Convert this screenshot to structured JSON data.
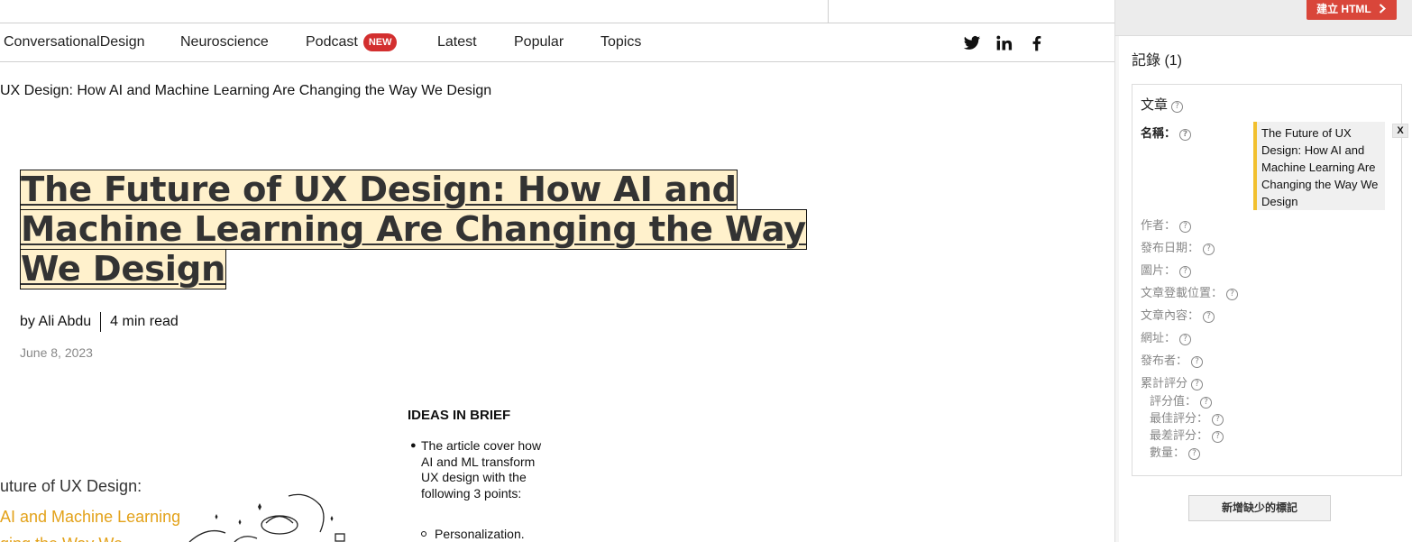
{
  "nav": {
    "items": [
      "ConversationalDesign",
      "Neuroscience",
      "Podcast",
      "Latest",
      "Popular",
      "Topics"
    ],
    "podcast_badge": "NEW",
    "social_icons": [
      "twitter-icon",
      "linkedin-icon",
      "facebook-icon"
    ]
  },
  "article": {
    "breadcrumb": "UX Design: How AI and Machine Learning Are Changing the Way We Design",
    "title_lines": [
      "The Future of UX Design: How AI and",
      "Machine Learning Are Changing the Way",
      "We Design"
    ],
    "author": "by Ali Abdu",
    "read_time": "4 min read",
    "date": "June 8, 2023",
    "brief_heading": "IDEAS IN BRIEF",
    "brief_text": "The article cover how AI and ML transform UX design with the following 3 points:",
    "brief_sub_item": "Personalization.",
    "image_text": [
      "uture of UX Design:",
      "AI and Machine Learning",
      "ging the Way We"
    ],
    "colors": {
      "highlight": "#fff1cc",
      "image_accent": "#e3a21a",
      "badge": "#d32f2f"
    }
  },
  "panel": {
    "create_button": "建立 HTML",
    "records_label": "記錄 (1)",
    "card_title": "文章",
    "name_label": "名稱：",
    "name_value": "The Future of UX Design: How AI and Machine Learning Are Changing the Way We Design",
    "remove_button": "X",
    "fields": [
      "作者：",
      "發布日期：",
      "圖片：",
      "文章登載位置：",
      "文章內容：",
      "網址：",
      "發布者：",
      "累計評分"
    ],
    "rating_fields": [
      "評分值：",
      "最佳評分：",
      "最差評分：",
      "數量："
    ],
    "help_glyph": "?",
    "add_missing_button": "新增缺少的標記",
    "colors": {
      "create_button": "#d9463a",
      "value_marker": "#f2c02f"
    }
  }
}
